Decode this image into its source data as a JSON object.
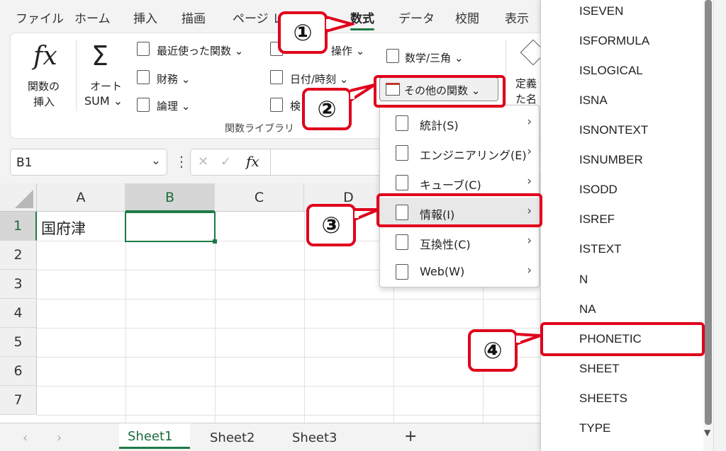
{
  "tabs": [
    "ファイル",
    "ホーム",
    "挿入",
    "描画",
    "ページ レ",
    "数式",
    "データ",
    "校閲",
    "表示"
  ],
  "ribbon": {
    "insert_function": [
      "関数の",
      "挿入"
    ],
    "fx": "fx",
    "autosum": [
      "オート",
      "SUM ⌄"
    ],
    "sigma": "Σ",
    "recent": "最近使った関数 ⌄",
    "finance": "財務 ⌄",
    "logic": "論理 ⌄",
    "lookup_partial": "操作 ⌄",
    "datetime": "日付/時刻 ⌄",
    "search_partial": "検",
    "math": "数学/三角 ⌄",
    "more_functions": "その他の関数 ⌄",
    "defined_partial": [
      "定義",
      "た名"
    ],
    "group_label": "関数ライブラリ"
  },
  "namebox": {
    "value": "B1",
    "chevron": "⌄"
  },
  "formulabar": {
    "cancel": "✕",
    "enter": "✓",
    "fx": "fx"
  },
  "grid": {
    "columns": [
      "A",
      "B",
      "C",
      "D"
    ],
    "rows": [
      "1",
      "2",
      "3",
      "4",
      "5",
      "6",
      "7"
    ],
    "cell_a1": "国府津",
    "selected": "B1"
  },
  "sheets": [
    "Sheet1",
    "Sheet2",
    "Sheet3"
  ],
  "sheet_nav": {
    "prev": "‹",
    "next": "›",
    "add": "+"
  },
  "submenu": [
    {
      "label": "統計(S)",
      "icon": "statistics-icon"
    },
    {
      "label": "エンジニアリング(E)",
      "icon": "engineering-icon"
    },
    {
      "label": "キューブ(C)",
      "icon": "cube-icon"
    },
    {
      "label": "情報(I)",
      "icon": "information-icon"
    },
    {
      "label": "互換性(C)",
      "icon": "compatibility-icon"
    },
    {
      "label": "Web(W)",
      "icon": "web-icon"
    }
  ],
  "functions": [
    "ISEVEN",
    "ISFORMULA",
    "ISLOGICAL",
    "ISNA",
    "ISNONTEXT",
    "ISNUMBER",
    "ISODD",
    "ISREF",
    "ISTEXT",
    "N",
    "NA",
    "PHONETIC",
    "SHEET",
    "SHEETS",
    "TYPE"
  ],
  "callouts": [
    "①",
    "②",
    "③",
    "④"
  ],
  "colors": {
    "accent": "#1d7a45",
    "highlight": "#e0001b"
  }
}
